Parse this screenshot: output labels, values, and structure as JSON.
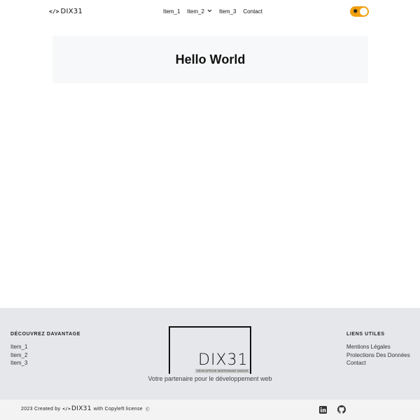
{
  "header": {
    "logo_code": "</>",
    "logo_text": "DIX31",
    "nav": [
      {
        "label": "Item_1"
      },
      {
        "label": "Item_2"
      },
      {
        "label": "Item_3"
      },
      {
        "label": "Contact"
      }
    ],
    "theme_toggle_icon": "sun-icon",
    "toggle_on": true
  },
  "hero": {
    "title": "Hello World"
  },
  "footer": {
    "left_heading": "DÉCOUVREZ DAVANTAGE",
    "left_links": [
      "Item_1",
      "Item_2",
      "Item_3"
    ],
    "brand_big": "DIX31",
    "brand_sub": "DÉVELOPPEUR INDÉPENDANT SAVEUR",
    "tagline": "Votre partenaire pour le développement web",
    "right_heading": "LIENS UTILES",
    "right_links": [
      "Mentions Légales",
      "Protections Des Données",
      "Contact"
    ]
  },
  "bottom": {
    "created": "2023 Created by",
    "logo_code": "</>",
    "logo_text": "DIX31",
    "license": "with Copyleft license",
    "license_mark": "Ⓒ",
    "socials": [
      "linkedin-icon",
      "github-icon"
    ]
  },
  "colors": {
    "accent": "#f0a010",
    "footer_bg": "#e6e7eb",
    "hero_bg": "#f7f8f9"
  }
}
